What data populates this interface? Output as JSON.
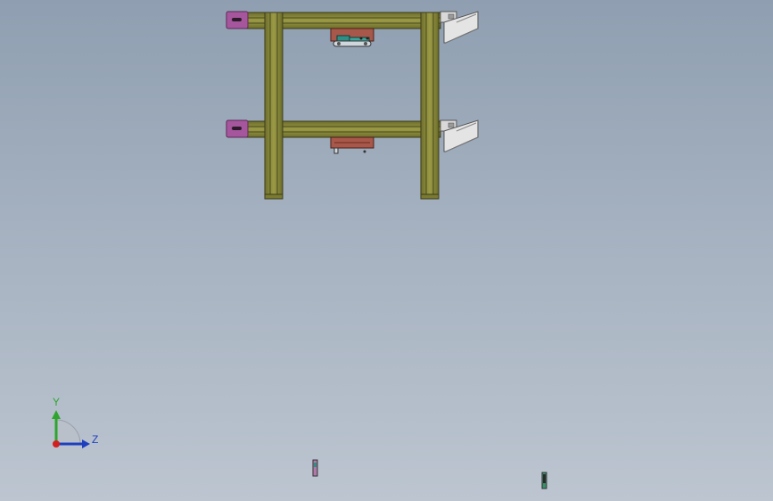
{
  "viewport": {
    "background_top": "#8f9fb1",
    "background_bottom": "#bcc5d0"
  },
  "model": {
    "frame_color": "#8c8c3c",
    "frame_edge_color": "#3b3b18",
    "end_plate_color": "#a6569c",
    "bracket_color": "#d9d9d9",
    "red_block_color": "#a8584a",
    "teal_part_color": "#2f8f86"
  },
  "triad": {
    "y_label": "Y",
    "z_label": "Z",
    "y_color": "#2fa52f",
    "z_color": "#1f3fbf",
    "origin_color": "#d21f1f"
  }
}
